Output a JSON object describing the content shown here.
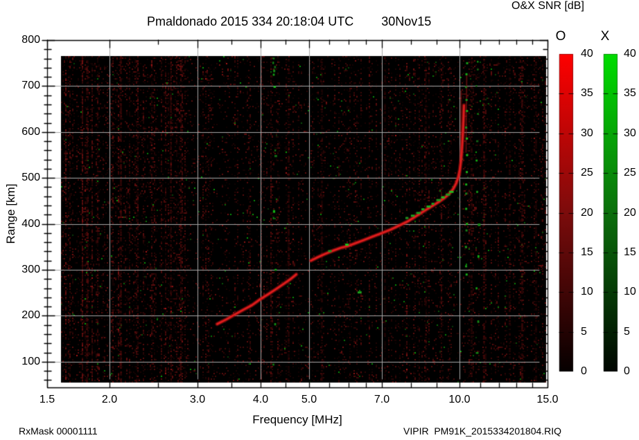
{
  "window": {
    "title_line": "Pmaldonado 2015 334 20:18:04 UTC        30Nov15"
  },
  "header": {
    "colorbar_title": "O&X SNR [dB]"
  },
  "footer": {
    "left": "RxMask 00001111",
    "right": "VIPIR  PM91K_2015334201804.RIQ"
  },
  "axes": {
    "x_label": "Frequency [MHz]",
    "y_label": "Range [km]",
    "x_major_ticks": [
      {
        "f": 1.5,
        "label": "1.5"
      },
      {
        "f": 2.0,
        "label": "2.0"
      },
      {
        "f": 3.0,
        "label": "3.0"
      },
      {
        "f": 4.0,
        "label": "4.0"
      },
      {
        "f": 5.0,
        "label": "5.0"
      },
      {
        "f": 7.0,
        "label": "7.0"
      },
      {
        "f": 10.0,
        "label": "10.0"
      },
      {
        "f": 15.0,
        "label": "15.0"
      }
    ],
    "x_minor_ticks": [
      2.5,
      3.5,
      4.5,
      5.5,
      6.0,
      6.5,
      8.0,
      9.0,
      11.0,
      12.0,
      13.0,
      14.0
    ],
    "y_major_ticks": [
      {
        "r": 100,
        "label": "100"
      },
      {
        "r": 200,
        "label": "200"
      },
      {
        "r": 300,
        "label": "300"
      },
      {
        "r": 400,
        "label": "400"
      },
      {
        "r": 500,
        "label": "500"
      },
      {
        "r": 600,
        "label": "600"
      },
      {
        "r": 700,
        "label": "700"
      },
      {
        "r": 800,
        "label": "800"
      }
    ],
    "y_minor_step": 20,
    "grid_x": [
      2,
      3,
      4,
      5,
      7,
      10
    ],
    "grid_y": [
      100,
      200,
      300,
      400,
      500,
      600,
      700
    ],
    "grid_color": "#a8a8a8"
  },
  "colorbars": {
    "o": {
      "header": "O",
      "top_color": "#ff0000",
      "mid_color": "#7c0c0c",
      "bottom_color": "#060000"
    },
    "x": {
      "header": "X",
      "top_color": "#00dd00",
      "mid_color": "#0c6f0c",
      "bottom_color": "#000600"
    },
    "tick_values": [
      40,
      35,
      30,
      25,
      20,
      15,
      10,
      5,
      0
    ],
    "tick_labels": [
      "40",
      "35",
      "30",
      "25",
      "20",
      "15",
      "10",
      "5",
      "0"
    ]
  },
  "chart_data": {
    "type": "heatmap",
    "title": "Pmaldonado 2015 334 20:18:04 UTC 30Nov15",
    "xlabel": "Frequency [MHz]",
    "ylabel": "Range [km]",
    "x_scale": "log",
    "xlim": [
      1.5,
      15.0
    ],
    "ylim": [
      44,
      800
    ],
    "value_label": "O&X SNR [dB]",
    "value_range": [
      0,
      40
    ],
    "data_extent": {
      "f_mhz": [
        1.6,
        14.9
      ],
      "range_km": [
        55,
        765
      ]
    },
    "o_trace_segment1_f_km": [
      [
        3.28,
        182
      ],
      [
        3.42,
        192
      ],
      [
        3.55,
        202
      ],
      [
        3.7,
        213
      ],
      [
        3.85,
        223
      ],
      [
        4.0,
        236
      ],
      [
        4.15,
        247
      ],
      [
        4.3,
        258
      ],
      [
        4.45,
        269
      ],
      [
        4.6,
        280
      ],
      [
        4.72,
        290
      ]
    ],
    "o_trace_segment2_f_km": [
      [
        5.05,
        320
      ],
      [
        5.2,
        327
      ],
      [
        5.4,
        335
      ],
      [
        5.6,
        342
      ],
      [
        5.8,
        348
      ],
      [
        6.0,
        352
      ],
      [
        6.2,
        358
      ],
      [
        6.45,
        365
      ],
      [
        6.7,
        372
      ],
      [
        7.0,
        380
      ],
      [
        7.3,
        388
      ],
      [
        7.6,
        397
      ],
      [
        7.9,
        406
      ],
      [
        8.2,
        417
      ],
      [
        8.5,
        428
      ],
      [
        8.8,
        438
      ],
      [
        9.1,
        448
      ],
      [
        9.35,
        457
      ],
      [
        9.55,
        466
      ],
      [
        9.72,
        476
      ],
      [
        9.85,
        488
      ],
      [
        9.95,
        502
      ],
      [
        10.02,
        518
      ],
      [
        10.08,
        540
      ],
      [
        10.12,
        565
      ],
      [
        10.16,
        595
      ],
      [
        10.19,
        630
      ],
      [
        10.21,
        658
      ]
    ],
    "x_trace_patches_f_km": [
      [
        7.85,
        412
      ],
      [
        8.05,
        417
      ],
      [
        8.25,
        423
      ],
      [
        8.45,
        431
      ],
      [
        8.65,
        437
      ],
      [
        8.85,
        443
      ],
      [
        9.05,
        451
      ],
      [
        9.25,
        457
      ],
      [
        9.45,
        463
      ],
      [
        9.6,
        469
      ],
      [
        5.5,
        340
      ],
      [
        5.95,
        354
      ],
      [
        6.3,
        250
      ]
    ],
    "x_asymptote": {
      "f_mhz": 10.32,
      "range_km": [
        292,
        310,
        352,
        388,
        402,
        435,
        468,
        488,
        515,
        552,
        588,
        612,
        648,
        672,
        700,
        728,
        752
      ]
    },
    "o_asymptotes": [
      {
        "f_mhz": 10.05,
        "range_km": [
          505,
          690
        ]
      },
      {
        "f_mhz": 10.31,
        "range_km": [
          555,
          725
        ]
      }
    ],
    "rfi_green_columns": [
      {
        "f_mhz": 4.27,
        "range_km": [
          762,
          753,
          744,
          736,
          727,
          700,
          562,
          550,
          430,
          415,
          302,
          184,
          96
        ]
      },
      {
        "f_mhz": 10.85,
        "range_km": [
          755,
          738,
          702,
          641,
          582,
          540,
          472,
          401,
          332,
          262,
          190,
          121
        ]
      }
    ],
    "rfi_red_streaks": [
      {
        "f_mhz": 1.8,
        "alpha": 0.5
      },
      {
        "f_mhz": 2.1,
        "alpha": 0.45
      },
      {
        "f_mhz": 2.65,
        "alpha": 0.4
      },
      {
        "f_mhz": 4.55,
        "alpha": 0.35
      },
      {
        "f_mhz": 5.3,
        "alpha": 0.3
      },
      {
        "f_mhz": 7.1,
        "alpha": 0.28
      },
      {
        "f_mhz": 8.55,
        "alpha": 0.28
      },
      {
        "f_mhz": 10.55,
        "alpha": 0.4
      },
      {
        "f_mhz": 11.2,
        "alpha": 0.55
      },
      {
        "f_mhz": 12.6,
        "alpha": 0.35
      },
      {
        "f_mhz": 13.35,
        "alpha": 0.5
      },
      {
        "f_mhz": 14.2,
        "alpha": 0.3
      }
    ],
    "noise": {
      "description": "dark red speckle background with vertical streaking, denser below 2.9 MHz, sparse green specks",
      "dense_below_mhz": 2.9,
      "seed": 1234
    }
  }
}
